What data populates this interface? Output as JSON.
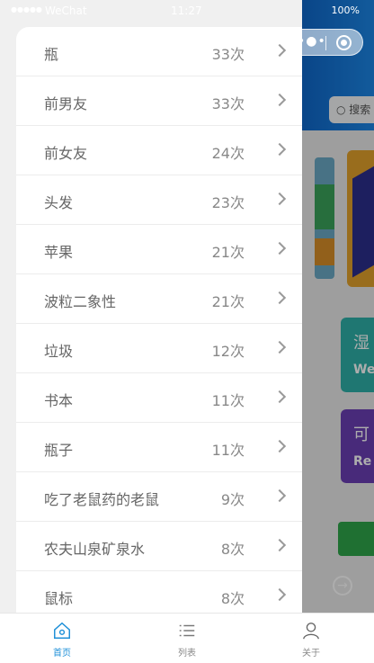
{
  "status_bar": {
    "signal": "●●●●●",
    "carrier": "WeChat",
    "time": "11:27",
    "battery": "100%"
  },
  "background": {
    "search_text": "搜索",
    "teal_title": "湿",
    "teal_sub": "We",
    "purple_title": "可",
    "purple_sub": "Re"
  },
  "list": [
    {
      "name": "瓶",
      "count": "33次"
    },
    {
      "name": "前男友",
      "count": "33次"
    },
    {
      "name": "前女友",
      "count": "24次"
    },
    {
      "name": "头发",
      "count": "23次"
    },
    {
      "name": "苹果",
      "count": "21次"
    },
    {
      "name": "波粒二象性",
      "count": "21次"
    },
    {
      "name": "垃圾",
      "count": "12次"
    },
    {
      "name": "书本",
      "count": "11次"
    },
    {
      "name": "瓶子",
      "count": "11次"
    },
    {
      "name": "吃了老鼠药的老鼠",
      "count": "9次"
    },
    {
      "name": "农夫山泉矿泉水",
      "count": "8次"
    },
    {
      "name": "鼠标",
      "count": "8次"
    }
  ],
  "tabs": [
    {
      "label": "首页",
      "icon": "home-icon",
      "active": true
    },
    {
      "label": "列表",
      "icon": "list-icon",
      "active": false
    },
    {
      "label": "关于",
      "icon": "user-icon",
      "active": false
    }
  ],
  "colors": {
    "accent": "#1f90d8",
    "header_blue": "#0f67c9",
    "teal": "#2fb0a8",
    "purple": "#6a3eb4"
  }
}
